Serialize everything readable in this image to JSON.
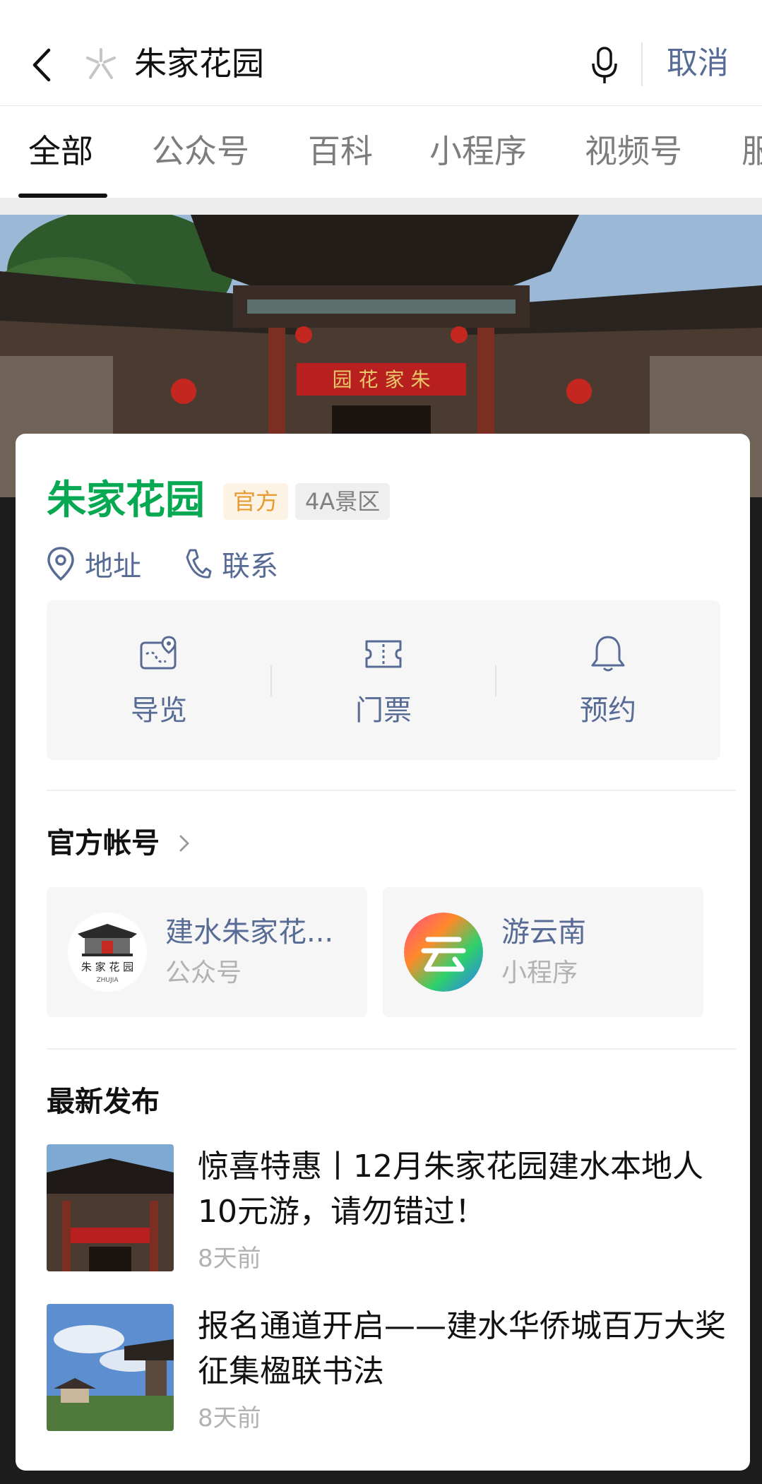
{
  "search": {
    "query": "朱家花园",
    "cancel_label": "取消"
  },
  "tabs": [
    {
      "label": "全部",
      "active": true
    },
    {
      "label": "公众号"
    },
    {
      "label": "百科"
    },
    {
      "label": "小程序"
    },
    {
      "label": "视频号"
    },
    {
      "label": "服"
    }
  ],
  "place": {
    "name": "朱家花园",
    "tags": [
      "官方",
      "4A景区"
    ],
    "links": [
      "地址",
      "联系"
    ],
    "colors": {
      "name": "#07a852",
      "link": "#576b95",
      "official_tag": "#e69b33"
    }
  },
  "services": [
    {
      "label": "导览",
      "icon": "map-pin-icon"
    },
    {
      "label": "门票",
      "icon": "ticket-icon"
    },
    {
      "label": "预约",
      "icon": "bell-icon"
    }
  ],
  "official_accounts": {
    "title": "官方帐号",
    "items": [
      {
        "name": "建水朱家花...",
        "type": "公众号",
        "avatar_text": "朱 家 花 园",
        "avatar_subtext": "ZHUJIA"
      },
      {
        "name": "游云南",
        "type": "小程序",
        "avatar_glyph": "云"
      }
    ]
  },
  "latest": {
    "title": "最新发布",
    "posts": [
      {
        "title": "惊喜特惠丨12月朱家花园建水本地人10元游，请勿错过！",
        "time": "8天前"
      },
      {
        "title": "报名通道开启——建水华侨城百万大奖征集楹联书法",
        "time": "8天前"
      }
    ]
  }
}
